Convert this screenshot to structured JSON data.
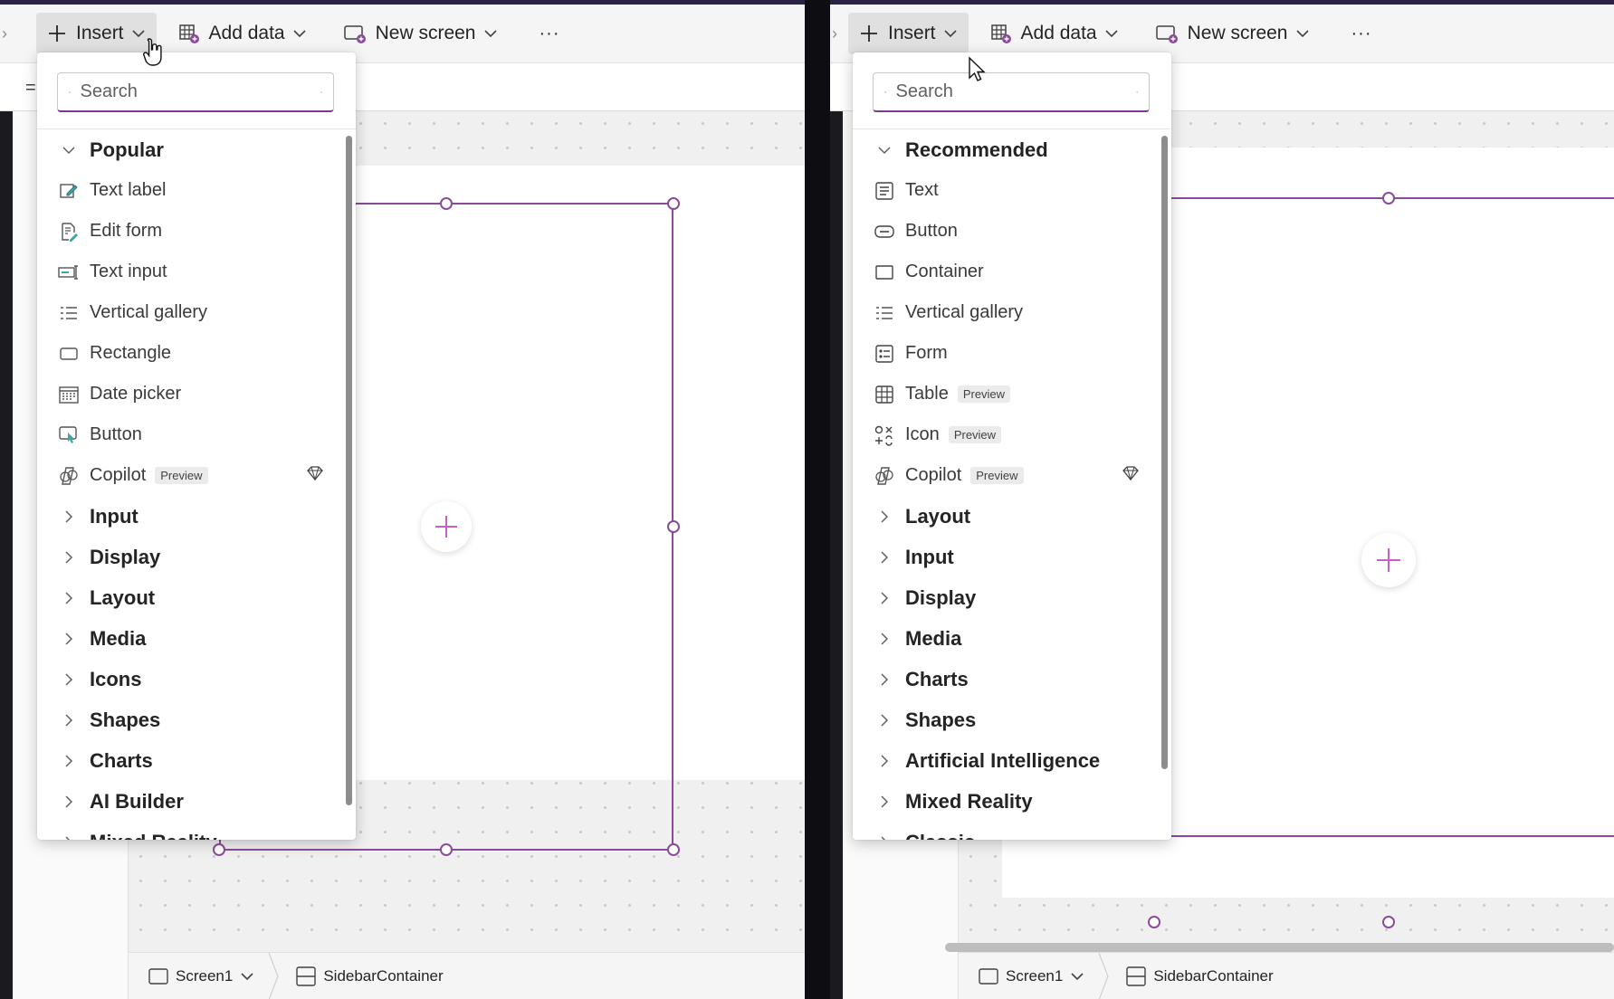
{
  "left": {
    "cmdbar": {
      "insert": "Insert",
      "add_data": "Add data",
      "new_screen": "New screen",
      "more": "···"
    },
    "search": {
      "placeholder": "Search"
    },
    "groups": [
      {
        "label": "Popular",
        "expanded": true,
        "items": [
          {
            "label": "Text label",
            "icon": "text-label-icon"
          },
          {
            "label": "Edit form",
            "icon": "edit-form-icon"
          },
          {
            "label": "Text input",
            "icon": "text-input-icon"
          },
          {
            "label": "Vertical gallery",
            "icon": "vertical-gallery-icon"
          },
          {
            "label": "Rectangle",
            "icon": "rectangle-icon"
          },
          {
            "label": "Date picker",
            "icon": "date-picker-icon"
          },
          {
            "label": "Button",
            "icon": "button-touch-icon"
          },
          {
            "label": "Copilot",
            "icon": "copilot-icon",
            "badge": "Preview",
            "premium": true
          }
        ]
      },
      {
        "label": "Input"
      },
      {
        "label": "Display"
      },
      {
        "label": "Layout"
      },
      {
        "label": "Media"
      },
      {
        "label": "Icons"
      },
      {
        "label": "Shapes"
      },
      {
        "label": "Charts"
      },
      {
        "label": "AI Builder"
      },
      {
        "label": "Mixed Reality"
      }
    ],
    "status": {
      "screen": "Screen1",
      "container": "SidebarContainer"
    }
  },
  "right": {
    "cmdbar": {
      "insert": "Insert",
      "add_data": "Add data",
      "new_screen": "New screen",
      "more": "···"
    },
    "search": {
      "placeholder": "Search"
    },
    "groups": [
      {
        "label": "Recommended",
        "expanded": true,
        "items": [
          {
            "label": "Text",
            "icon": "text-icon"
          },
          {
            "label": "Button",
            "icon": "button-icon"
          },
          {
            "label": "Container",
            "icon": "container-icon"
          },
          {
            "label": "Vertical gallery",
            "icon": "vertical-gallery-icon"
          },
          {
            "label": "Form",
            "icon": "form-icon"
          },
          {
            "label": "Table",
            "icon": "table-icon",
            "badge": "Preview"
          },
          {
            "label": "Icon",
            "icon": "icon-shapes-icon",
            "badge": "Preview"
          },
          {
            "label": "Copilot",
            "icon": "copilot-icon",
            "badge": "Preview",
            "premium": true
          }
        ]
      },
      {
        "label": "Layout"
      },
      {
        "label": "Input"
      },
      {
        "label": "Display"
      },
      {
        "label": "Media"
      },
      {
        "label": "Charts"
      },
      {
        "label": "Shapes"
      },
      {
        "label": "Artificial Intelligence"
      },
      {
        "label": "Mixed Reality"
      },
      {
        "label": "Classic"
      }
    ],
    "status": {
      "screen": "Screen1",
      "container": "SidebarContainer"
    }
  },
  "colors": {
    "accent": "#8a4b9a",
    "plus": "#c660c6",
    "divider": "#000000"
  }
}
